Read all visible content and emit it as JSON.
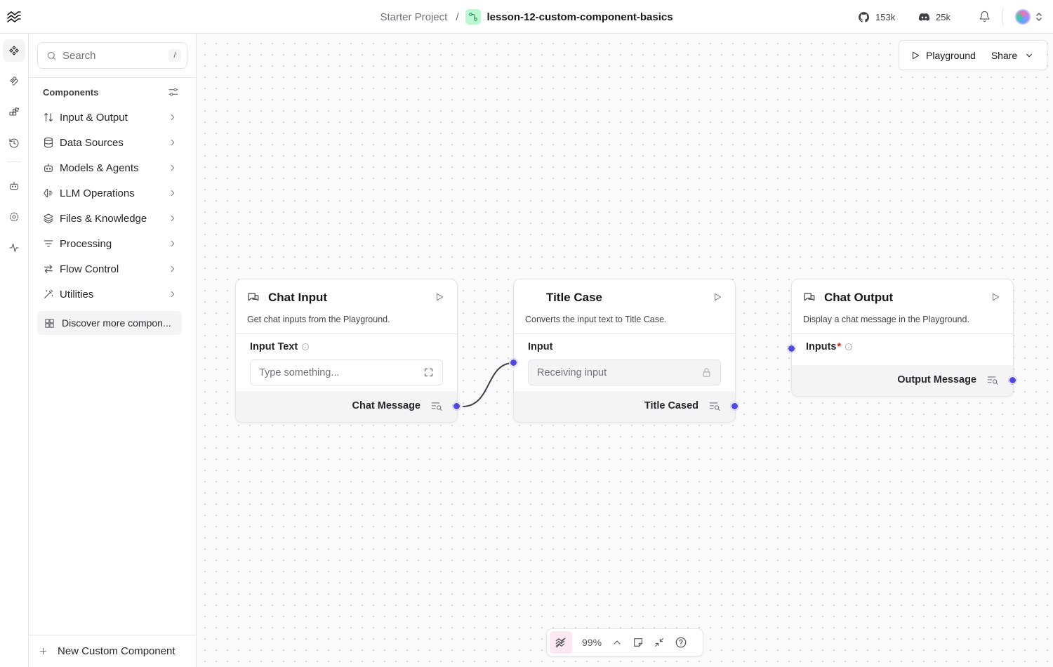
{
  "header": {
    "project": "Starter Project",
    "separator": "/",
    "flow_name": "lesson-12-custom-component-basics",
    "github_stars": "153k",
    "discord_members": "25k"
  },
  "rail": {
    "items": [
      "components-icon",
      "mcp-icon",
      "bundles-icon",
      "history-icon",
      "agent-icon",
      "settings-icon",
      "activity-icon"
    ]
  },
  "sidebar": {
    "search_placeholder": "Search",
    "search_shortcut": "/",
    "components_title": "Components",
    "categories": [
      {
        "label": "Input & Output",
        "icon": "input-output-icon"
      },
      {
        "label": "Data Sources",
        "icon": "database-icon"
      },
      {
        "label": "Models & Agents",
        "icon": "bot-icon"
      },
      {
        "label": "LLM Operations",
        "icon": "brain-icon"
      },
      {
        "label": "Files & Knowledge",
        "icon": "layers-icon"
      },
      {
        "label": "Processing",
        "icon": "filter-icon"
      },
      {
        "label": "Flow Control",
        "icon": "arrows-icon"
      },
      {
        "label": "Utilities",
        "icon": "wand-icon"
      }
    ],
    "discover_label": "Discover more compon...",
    "new_component_label": "New Custom Component"
  },
  "toolbar": {
    "playground_label": "Playground",
    "share_label": "Share"
  },
  "nodes": {
    "chat_input": {
      "title": "Chat Input",
      "description": "Get chat inputs from the Playground.",
      "field_label": "Input Text",
      "field_placeholder": "Type something...",
      "output_label": "Chat Message"
    },
    "title_case": {
      "title": "Title Case",
      "description": "Converts the input text to Title Case.",
      "field_label": "Input",
      "field_value": "Receiving input",
      "output_label": "Title Cased"
    },
    "chat_output": {
      "title": "Chat Output",
      "description": "Display a chat message in the Playground.",
      "field_label": "Inputs",
      "required_mark": "*",
      "output_label": "Output Message"
    }
  },
  "canvas_controls": {
    "zoom": "99%"
  },
  "colors": {
    "handle": "#4f46e5",
    "flow_badge_bg": "#bbf7d0",
    "required": "#dc2626"
  }
}
